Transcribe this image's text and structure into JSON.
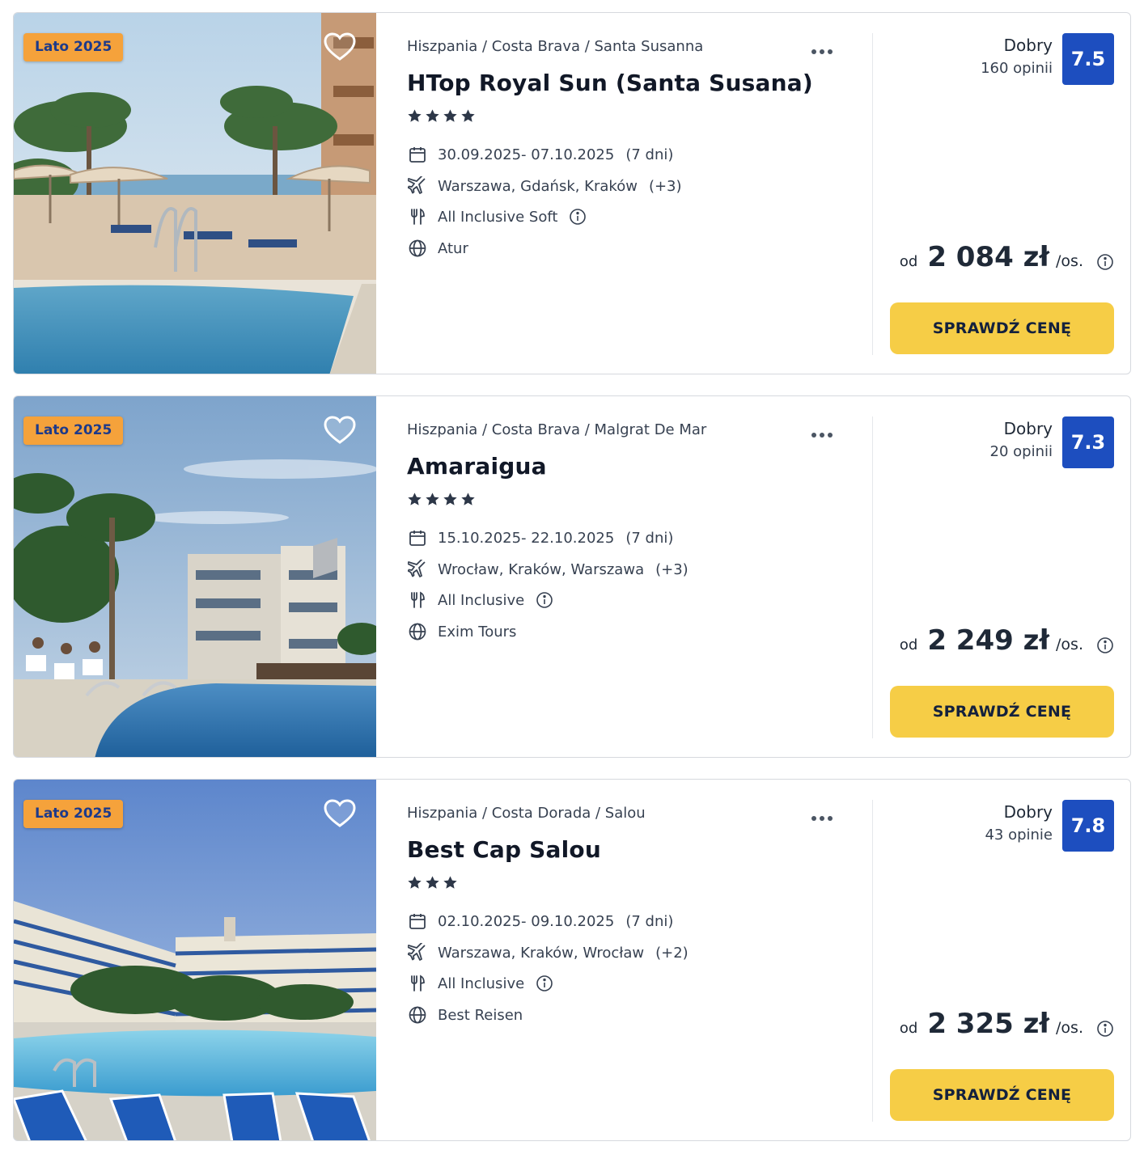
{
  "colors": {
    "season_badge": "#f5a23b",
    "season_text": "#1d3a8a",
    "score_badge": "#1d4ebf",
    "cta_button": "#f6cd46"
  },
  "offers": [
    {
      "season": "Lato 2025",
      "breadcrumb": "Hiszpania / Costa Brava / Santa Susanna",
      "name": "HTop Royal Sun (Santa Susana)",
      "stars": 4,
      "dates": "30.09.2025- 07.10.2025",
      "duration": "(7 dni)",
      "departure": "Warszawa, Gdańsk, Kraków",
      "departure_extra": "(+3)",
      "board": "All Inclusive Soft",
      "operator": "Atur",
      "rating_label": "Dobry",
      "reviews": "160 opinii",
      "score": "7.5",
      "price_prefix": "od",
      "price": "2 084 zł",
      "price_suffix": "/os.",
      "cta": "SPRAWDŹ CENĘ",
      "image": "pool-terrace-sea-view"
    },
    {
      "season": "Lato 2025",
      "breadcrumb": "Hiszpania / Costa Brava / Malgrat De Mar",
      "name": "Amaraigua",
      "stars": 4,
      "dates": "15.10.2025- 22.10.2025",
      "duration": "(7 dni)",
      "departure": "Wrocław, Kraków, Warszawa",
      "departure_extra": "(+3)",
      "board": "All Inclusive",
      "operator": "Exim Tours",
      "rating_label": "Dobry",
      "reviews": "20 opinii",
      "score": "7.3",
      "price_prefix": "od",
      "price": "2 249 zł",
      "price_suffix": "/os.",
      "cta": "SPRAWDŹ CENĘ",
      "image": "hotel-building-pool-palms"
    },
    {
      "season": "Lato 2025",
      "breadcrumb": "Hiszpania / Costa Dorada / Salou",
      "name": "Best Cap Salou",
      "stars": 3,
      "dates": "02.10.2025- 09.10.2025",
      "duration": "(7 dni)",
      "departure": "Warszawa, Kraków, Wrocław",
      "departure_extra": "(+2)",
      "board": "All Inclusive",
      "operator": "Best Reisen",
      "rating_label": "Dobry",
      "reviews": "43 opinie",
      "score": "7.8",
      "price_prefix": "od",
      "price": "2 325 zł",
      "price_suffix": "/os.",
      "cta": "SPRAWDŹ CENĘ",
      "image": "large-hotel-pool-sunbeds"
    }
  ]
}
